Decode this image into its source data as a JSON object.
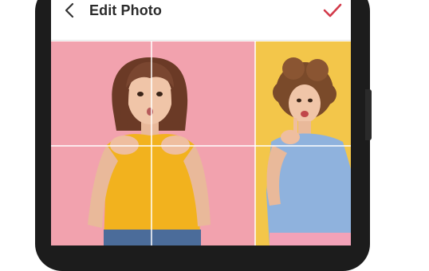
{
  "header": {
    "title": "Edit Photo",
    "back_icon": "chevron-left-icon",
    "confirm_icon": "checkmark-icon"
  },
  "colors": {
    "accent": "#d23a4a",
    "left_photo_bg": "#f2a2ae",
    "right_photo_bg": "#f3c64a",
    "phone_frame": "#1c1c1c"
  }
}
